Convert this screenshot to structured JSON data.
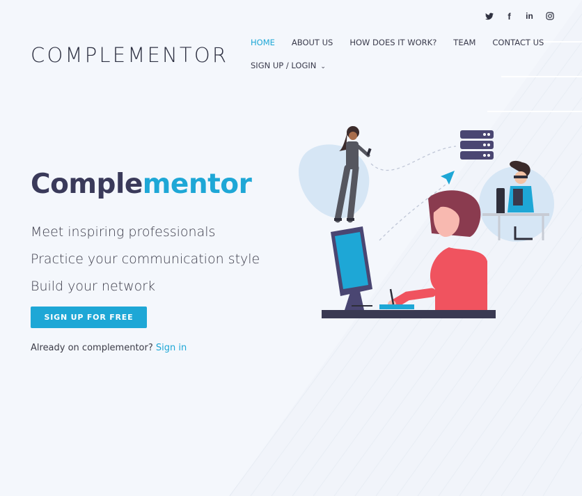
{
  "brand": {
    "logo": "COMPLEMENTOR"
  },
  "social": [
    {
      "icon": "twitter-icon",
      "glyph": "🐦"
    },
    {
      "icon": "facebook-icon",
      "glyph": "f"
    },
    {
      "icon": "linkedin-icon",
      "glyph": "in"
    },
    {
      "icon": "instagram-icon",
      "glyph": "◎"
    }
  ],
  "nav": {
    "home": "HOME",
    "about": "ABOUT US",
    "how": "HOW DOES IT WORK?",
    "team": "TEAM",
    "contact": "CONTACT US",
    "signup": "SIGN UP / LOGIN"
  },
  "hero": {
    "title_part1": "Comple",
    "title_part2": "mentor",
    "taglines": [
      "Meet inspiring professionals",
      "Practice your communication style",
      "Build your network"
    ],
    "cta": "SIGN UP FOR FREE",
    "already_text": "Already on complementor? ",
    "signin": "Sign in"
  },
  "colors": {
    "accent": "#1ea7d6",
    "title": "#3a3a5a",
    "background": "#f4f7fc"
  }
}
